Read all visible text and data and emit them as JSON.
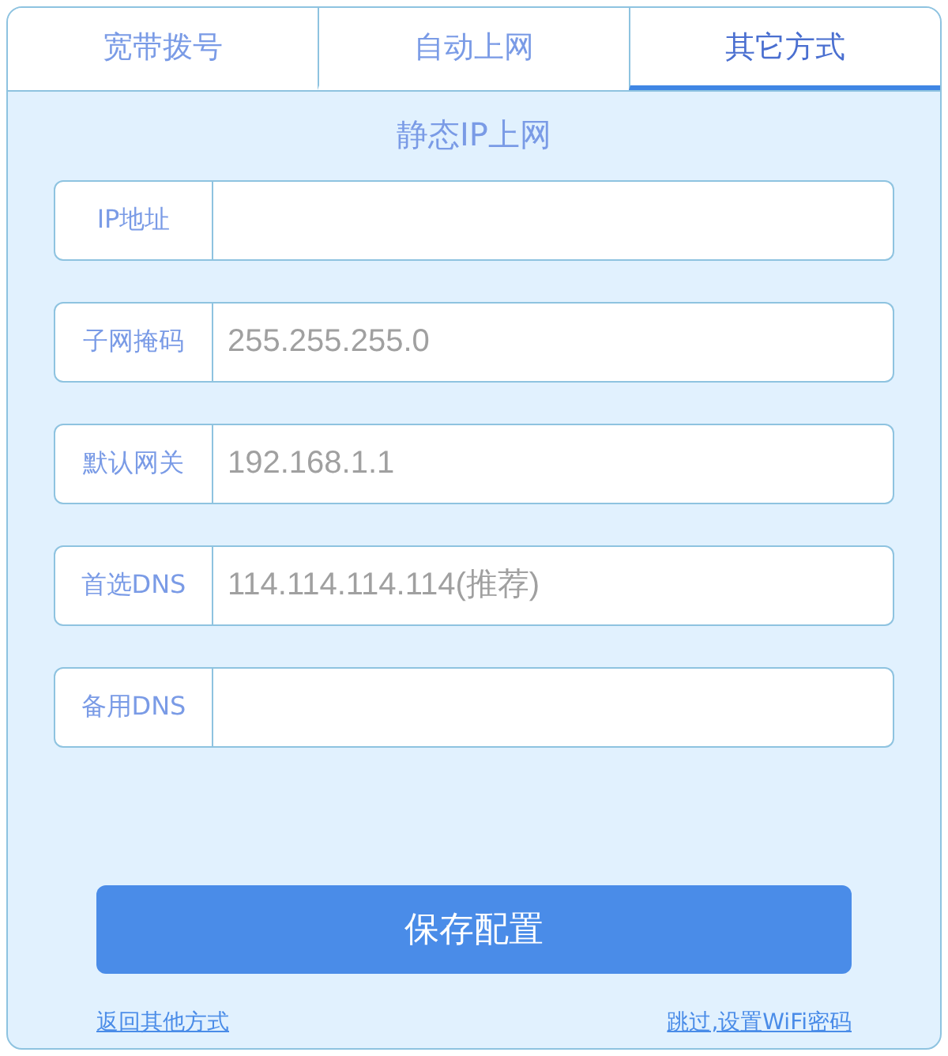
{
  "tabs": [
    {
      "label": "宽带拨号",
      "selected": false
    },
    {
      "label": "自动上网",
      "selected": false
    },
    {
      "label": "其它方式",
      "selected": true
    }
  ],
  "title": "静态IP上网",
  "fields": [
    {
      "label": "IP地址"
    },
    {
      "label": "子网掩码",
      "placeholder": "255.255.255.0"
    },
    {
      "label": "默认网关",
      "placeholder": "192.168.1.1"
    },
    {
      "label": "首选DNS",
      "placeholder": "114.114.114.114(推荐)"
    },
    {
      "label": "备用DNS"
    }
  ],
  "save_button": "保存配置",
  "links": {
    "back": "返回其他方式",
    "skip": "跳过,设置WiFi密码"
  }
}
